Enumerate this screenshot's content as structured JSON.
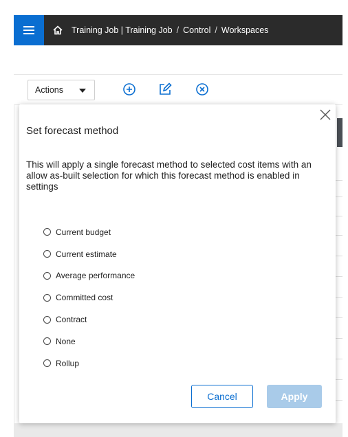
{
  "topbar": {
    "menu_icon": "hamburger-icon",
    "home_icon": "home-icon",
    "breadcrumb": [
      "Training Job | Training Job",
      "Control",
      "Workspaces"
    ],
    "separator": "/",
    "accent_color": "#0a6ed1",
    "bar_color": "#2b2b2b"
  },
  "toolbar": {
    "actions_label": "Actions",
    "icons": [
      "add-circle-icon",
      "edit-icon",
      "remove-circle-icon"
    ]
  },
  "modal": {
    "title": "Set forecast method",
    "description": "This will apply a single forecast method to selected cost items with an allow as-built selection for which this forecast method is enabled in settings",
    "options": [
      "Current budget",
      "Current estimate",
      "Average performance",
      "Committed cost",
      "Contract",
      "None",
      "Rollup"
    ],
    "cancel_label": "Cancel",
    "apply_label": "Apply",
    "apply_color": "#a9cbe9"
  }
}
